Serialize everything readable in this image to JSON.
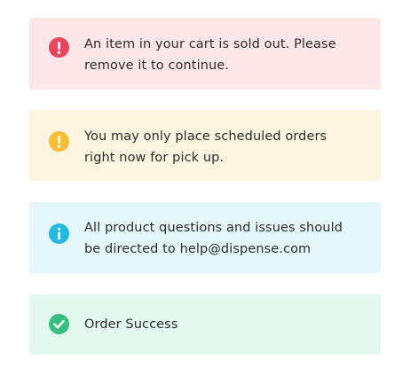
{
  "alerts": {
    "error": {
      "icon": "exclamation-icon",
      "message": "An item in your cart is sold out. Please remove it to continue.",
      "color": "#e9465a",
      "background": "#fde6e8"
    },
    "warning": {
      "icon": "exclamation-icon",
      "message": "You may only place scheduled orders right now for pick up.",
      "color": "#f7bd37",
      "background": "#fef5e1"
    },
    "info": {
      "icon": "info-icon",
      "message": "All product questions and issues should be directed to help@dispense.com",
      "color": "#27b8e2",
      "background": "#e4f7fc"
    },
    "success": {
      "icon": "checkmark-icon",
      "message": "Order Success",
      "color": "#36bf7f",
      "background": "#e3f8ef"
    }
  }
}
